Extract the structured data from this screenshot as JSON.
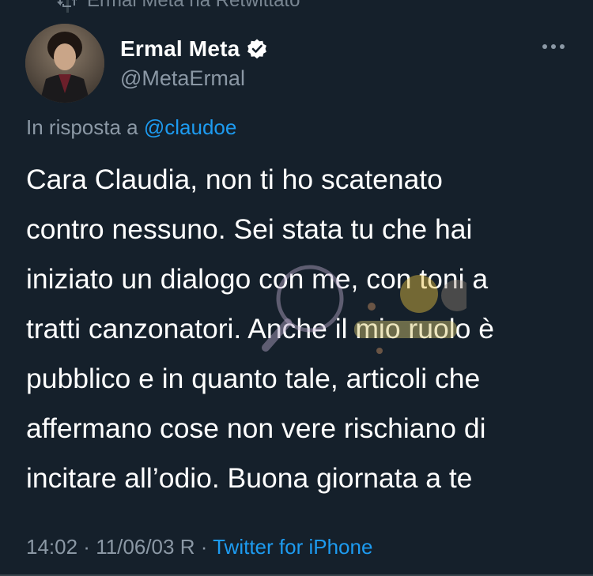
{
  "retweet": {
    "label": "Ermal Meta ha Retwittato"
  },
  "author": {
    "display_name": "Ermal Meta",
    "handle": "@MetaErmal",
    "verified": true
  },
  "reply": {
    "prefix": "In risposta a",
    "mention": "@claudoe"
  },
  "tweet": {
    "lines": [
      "Cara Claudia, non ti ho scatenato",
      "contro nessuno. Sei stata tu che hai",
      "iniziato un dialogo con me, con toni a",
      "tratti canzonatori. Anche il mio ruolo è",
      "pubblico e in quanto tale, articoli che",
      "affermano cose non vere rischiano di",
      "incitare all’odio. Buona giornata a te"
    ]
  },
  "meta": {
    "time": "14:02",
    "separator": " · ",
    "date": "11/06/03 R",
    "source": "Twitter for iPhone"
  },
  "icons": {
    "retweet": "retweet-icon",
    "verified": "verified-badge-icon",
    "more": "more-options-icon"
  },
  "colors": {
    "background": "#15202b",
    "text": "#ffffff",
    "secondary": "#8b98a5",
    "link": "#1d9bf0"
  }
}
